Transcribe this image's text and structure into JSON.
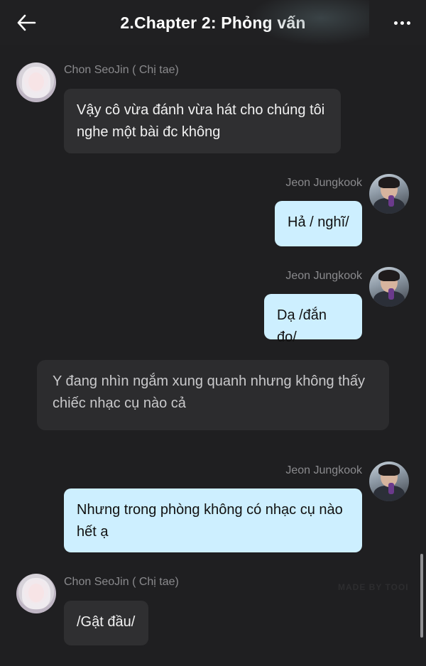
{
  "header": {
    "title": "2.Chapter 2: Phỏng vấn"
  },
  "icons": {
    "back": "back-arrow-icon",
    "more": "more-dots-icon"
  },
  "colors": {
    "background": "#1f1f21",
    "left_bubble": "#2f2f31",
    "right_bubble": "#cdefff",
    "name_text": "#8a8a8d"
  },
  "messages": [
    {
      "speaker": "Chon SeoJin ( Chị tae)",
      "side": "left",
      "text": "Vậy cô vừa đánh vừa hát cho chúng tôi nghe một bài đc không"
    },
    {
      "speaker": "Jeon Jungkook",
      "side": "right",
      "text": "Hả / nghĩ/"
    },
    {
      "speaker": "Jeon Jungkook",
      "side": "right",
      "text": "Dạ /đắn đo/"
    },
    {
      "speaker": "",
      "side": "narration",
      "text": "Y đang nhìn ngắm xung quanh nhưng không thấy chiếc nhạc cụ nào cả"
    },
    {
      "speaker": "Jeon Jungkook",
      "side": "right",
      "text": "Nhưng trong phòng không có nhạc cụ nào hết ạ"
    },
    {
      "speaker": "Chon SeoJin ( Chị tae)",
      "side": "left",
      "text": "/Gật đầu/"
    }
  ],
  "watermark": "MADE BY TOOI"
}
